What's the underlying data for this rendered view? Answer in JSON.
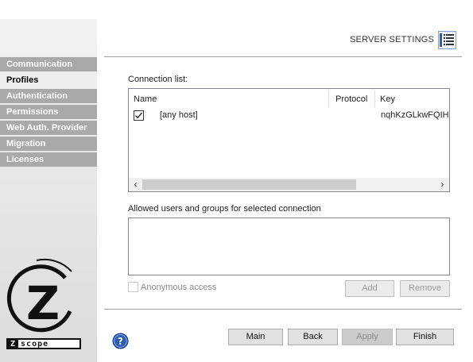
{
  "sidebar": {
    "items": [
      {
        "label": "Communication"
      },
      {
        "label": "Profiles",
        "active": true
      },
      {
        "label": "Authentication"
      },
      {
        "label": "Permissions"
      },
      {
        "label": "Web Auth. Provider"
      },
      {
        "label": "Migration"
      },
      {
        "label": "Licenses"
      }
    ],
    "logo": {
      "letter": "Z",
      "word_first": "Z",
      "word_rest": "scope"
    }
  },
  "header": {
    "title": "SERVER SETTINGS",
    "icon": "settings-list-icon"
  },
  "connection_list": {
    "label": "Connection list:",
    "columns": [
      "Name",
      "Protocol",
      "Key"
    ],
    "rows": [
      {
        "checked": true,
        "name": "[any host]",
        "protocol": "",
        "key": "nqhKzGLkwFQIHJI"
      }
    ]
  },
  "users_section": {
    "label": "Allowed users and groups for selected  connection"
  },
  "anonymous": {
    "label": "Anonymous access",
    "checked": false,
    "enabled": false
  },
  "buttons": {
    "add": "Add",
    "remove": "Remove",
    "main": "Main",
    "back": "Back",
    "apply": "Apply",
    "finish": "Finish"
  },
  "colors": {
    "sidebar_item_bg": "#a9a9a9",
    "accent_blue": "#2a5db0"
  }
}
